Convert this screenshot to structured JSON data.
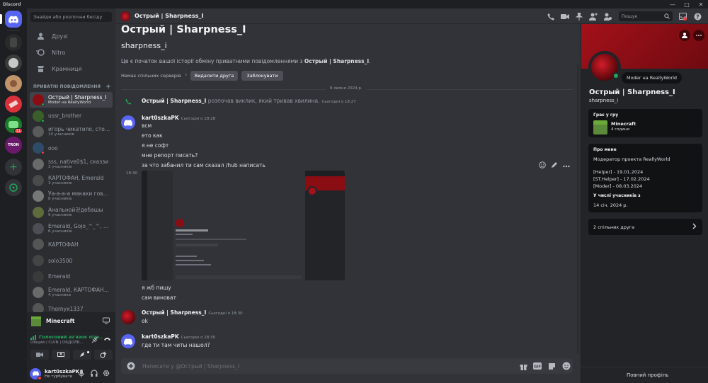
{
  "app": {
    "title": "Discord"
  },
  "sidebar": {
    "search_placeholder": "Знайди або розпочни бесіду",
    "nav": [
      {
        "label": "Друзі",
        "icon": "friends-icon"
      },
      {
        "label": "Nitro",
        "icon": "nitro-icon"
      },
      {
        "label": "Крамниця",
        "icon": "shop-icon"
      }
    ],
    "dm_header": "ПРИВАТНІ ПОВІДОМЛЕННЯ",
    "dms": [
      {
        "name": "Острый | Sharpness_I",
        "sub": "Moder на ReallyWorld",
        "color": "#8b0d14",
        "status": "#23a55a",
        "active": true
      },
      {
        "name": "ussr_brother",
        "sub": "",
        "color": "#3a5f2b",
        "status": "#23a55a"
      },
      {
        "name": "игорь чикатило, стоматолог",
        "sub": "10 учасників",
        "color": "#5a5a5a",
        "status": ""
      },
      {
        "name": "ooo",
        "sub": "",
        "color": "#2e4b6a",
        "status": "#f23f42"
      },
      {
        "name": "sss, native0$1, сказзи",
        "sub": "3 учасників",
        "color": "#6a6a6a",
        "status": ""
      },
      {
        "name": "КАРТОФАН, Emerald",
        "sub": "3 учасників",
        "color": "#4a4a4a",
        "status": ""
      },
      {
        "name": "Уа-а-а-а макаки говорящие",
        "sub": "8 учасників",
        "color": "#777",
        "status": ""
      },
      {
        "name": "Анальной卍дебашы",
        "sub": "9 учасників",
        "color": "#5e6b3a",
        "status": ""
      },
      {
        "name": "Emerald, Gojo_^_^, C...",
        "sub": "6 учасників",
        "color": "#4d4d55",
        "status": ""
      },
      {
        "name": "КАРТОФАН",
        "sub": "",
        "color": "#555",
        "status": ""
      },
      {
        "name": "solo3500",
        "sub": "",
        "color": "#444",
        "status": ""
      },
      {
        "name": "Emerald",
        "sub": "",
        "color": "#3a3a3a",
        "status": ""
      },
      {
        "name": "Emerald, КАРТОФАН, ...",
        "sub": "4 учасника",
        "color": "#6a6a6a",
        "status": ""
      },
      {
        "name": "Thornyx1337",
        "sub": "",
        "color": "#555",
        "status": ""
      }
    ]
  },
  "activity": {
    "game": "Minecraft"
  },
  "voice": {
    "status": "Голосовий зв'язок під...",
    "channel": "Общий / CLVN | ОБДОЛБ..."
  },
  "user": {
    "name": "kart0szkaPK",
    "status": "Не турбувати"
  },
  "header": {
    "name": "Острый | Sharpness_I",
    "search_placeholder": "Пошук"
  },
  "intro": {
    "title": "Острый | Sharpness_I",
    "username": "sharpness_i",
    "text_before": "Це є початок вашої історії обміну приватними повідомленнями з ",
    "text_name": "Острый | Sharpness_I",
    "text_after": ".",
    "mutual": "Немає спільних серверів",
    "remove_friend": "Видалити друга",
    "block": "Заблокувати"
  },
  "date_divider": "8 липня 2024 р.",
  "call": {
    "name": "Острый | Sharpness_I",
    "text": " розпочав виклик, який тривав хвилина.",
    "time": "Сьогодні о 18:27"
  },
  "messages": {
    "m1": {
      "author": "kart0szkaPK",
      "time": "Сьогодні о 18:28",
      "lines": [
        "всм",
        "ето как",
        "я не софт",
        "мне репорт писать?",
        "за что забанил ти сам сказал /hub написать"
      ]
    },
    "hover_time": "18:30",
    "m1b": {
      "lines": [
        "я жб пишу",
        "сам виноват"
      ]
    },
    "m2": {
      "author": "Острый | Sharpness_I",
      "time": "Сьогодні о 18:30",
      "lines": [
        "ok"
      ]
    },
    "m3": {
      "author": "kart0szkaPK",
      "time": "Сьогодні о 18:30",
      "lines": [
        "где ти там читы нашол?"
      ]
    }
  },
  "composer": {
    "placeholder": "Написати у @Острый | Sharpness_I"
  },
  "profile": {
    "tooltip": "Moder на ReallyWorld",
    "name": "Острый | Sharpness_I",
    "username": "sharpness_i",
    "playing_title": "Грає у гру",
    "game": "Minecraft",
    "game_time": "4 години",
    "about_title": "Про мене",
    "about_lines": [
      "Модератор проекта ReallyWorld",
      "[Helper] - 19.01.2024",
      "[ST.Helper] - 17.02.2024",
      "[Moder] - 08.03.2024"
    ],
    "member_since_title": "У числі учасників з",
    "member_since": "14 січ. 2024 р.",
    "mutual_friends": "2 спільних друга",
    "full_profile": "Повний профіль"
  },
  "colors": {
    "accent": "#5865f2",
    "online": "#23a55a",
    "dnd": "#f23f42",
    "banner": "#a4111a"
  }
}
